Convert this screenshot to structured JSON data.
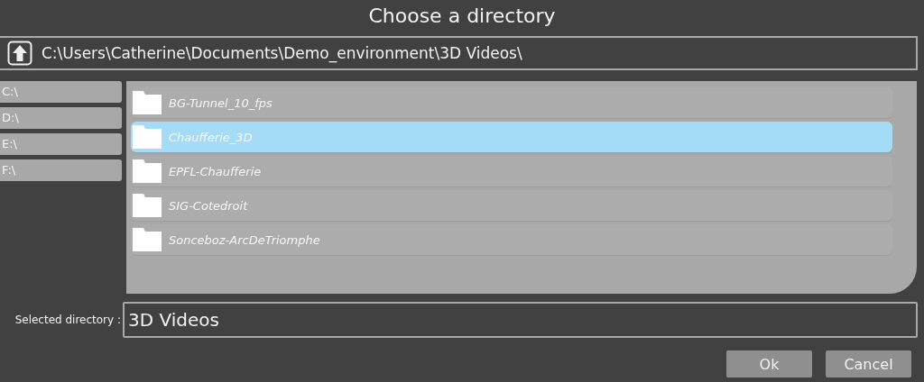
{
  "window": {
    "title": "Choose a directory"
  },
  "path": "C:\\Users\\Catherine\\Documents\\Demo_environment\\3D Videos\\",
  "drives": [
    {
      "label": "C:\\",
      "selected": false
    },
    {
      "label": "D:\\",
      "selected": false
    },
    {
      "label": "E:\\",
      "selected": false
    },
    {
      "label": "F:\\",
      "selected": false
    }
  ],
  "folders": [
    {
      "name": "BG-Tunnel_10_fps",
      "selected": false
    },
    {
      "name": "Chaufferie_3D",
      "selected": true
    },
    {
      "name": "EPFL-Chaufferie",
      "selected": false
    },
    {
      "name": "SIG-Cotedroit",
      "selected": false
    },
    {
      "name": "Sonceboz-ArcDeTriomphe",
      "selected": false
    }
  ],
  "selected_directory": {
    "label": "Selected directory :",
    "value": "3D Videos"
  },
  "buttons": [
    "Ok",
    "Cancel"
  ]
}
